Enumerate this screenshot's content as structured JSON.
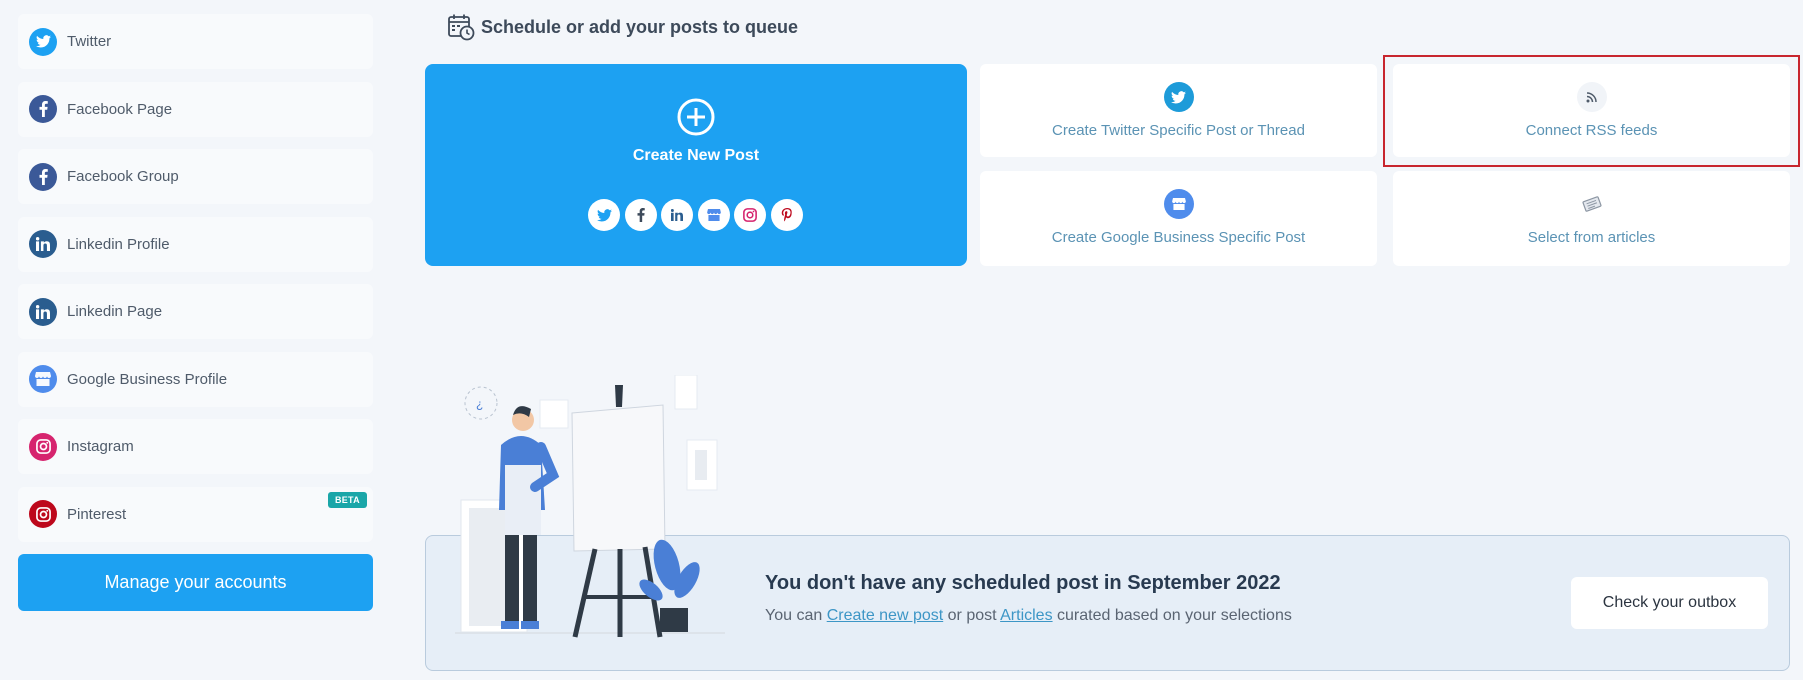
{
  "sidebar": {
    "accounts": [
      {
        "label": "Twitter",
        "icon": "twitter-icon",
        "color": "#1da1f2"
      },
      {
        "label": "Facebook Page",
        "icon": "facebook-icon",
        "color": "#3b5998"
      },
      {
        "label": "Facebook Group",
        "icon": "facebook-icon",
        "color": "#3b5998"
      },
      {
        "label": "Linkedin Profile",
        "icon": "linkedin-icon",
        "color": "#2a5d8f"
      },
      {
        "label": "Linkedin Page",
        "icon": "linkedin-icon",
        "color": "#2a5d8f"
      },
      {
        "label": "Google Business Profile",
        "icon": "google-business-icon",
        "color": "#4f8cec"
      },
      {
        "label": "Instagram",
        "icon": "instagram-icon",
        "color": "#d6246e"
      },
      {
        "label": "Pinterest",
        "icon": "pinterest-icon",
        "color": "#bd081c",
        "badge": "BETA"
      }
    ],
    "manage_label": "Manage your accounts"
  },
  "header": {
    "title": "Schedule or add your posts to queue",
    "icon": "calendar-clock-icon"
  },
  "create_card": {
    "title": "Create New Post",
    "color": "#1da1f2",
    "network_icons": [
      "twitter-icon",
      "facebook-icon",
      "linkedin-icon",
      "google-business-icon",
      "instagram-icon",
      "pinterest-icon"
    ]
  },
  "options": {
    "twitter_thread": "Create Twitter Specific Post or Thread",
    "rss": "Connect RSS feeds",
    "google_business": "Create Google Business Specific Post",
    "articles": "Select from articles"
  },
  "empty_state": {
    "title": "You don't have any scheduled post in September 2022",
    "sub_prefix": "You can ",
    "create_link": "Create new post",
    "sub_mid": " or post ",
    "articles_link": "Articles",
    "sub_suffix": " curated based on your selections",
    "outbox_label": "Check your outbox"
  }
}
